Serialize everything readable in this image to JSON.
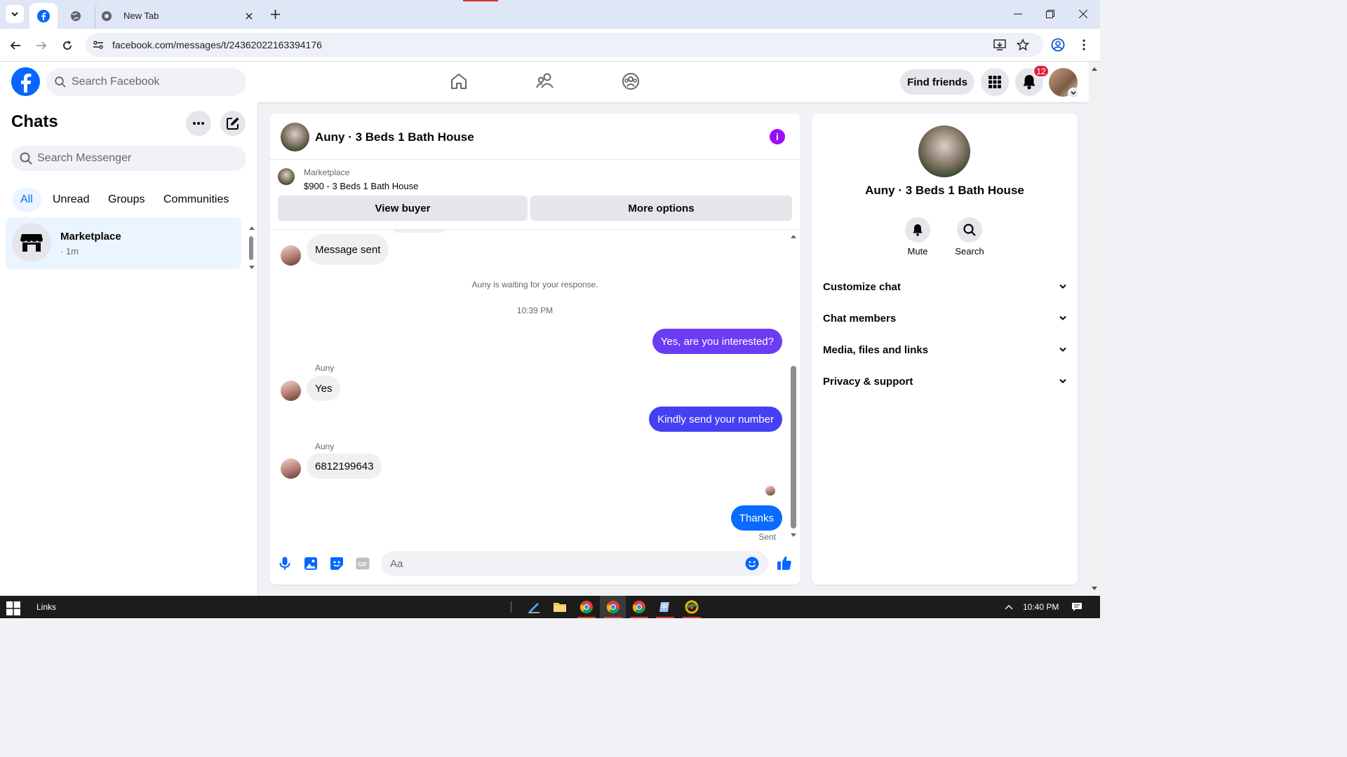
{
  "browser": {
    "tabs": [
      {
        "label": "",
        "icon": "facebook-icon",
        "active": true
      },
      {
        "label": "",
        "icon": "globe-icon"
      },
      {
        "label": "New Tab",
        "icon": "chrome-icon"
      }
    ],
    "url": "facebook.com/messages/t/24362022163394176"
  },
  "fb": {
    "search_placeholder": "Search Facebook",
    "find_friends": "Find friends",
    "notification_count": "12"
  },
  "chats": {
    "title": "Chats",
    "search_placeholder": "Search Messenger",
    "filters": [
      "All",
      "Unread",
      "Groups",
      "Communities"
    ],
    "items": [
      {
        "name": "Marketplace",
        "sub": "· 1m"
      }
    ]
  },
  "conversation": {
    "title": "Auny · 3 Beds 1 Bath House",
    "marketplace_label": "Marketplace",
    "listing": "$900 - 3 Beds 1 Bath House",
    "view_buyer": "View buyer",
    "more_options": "More options",
    "messages": {
      "m1": "Message sent",
      "waiting": "Auny is waiting for your response.",
      "time": "10:39 PM",
      "m2": "Yes, are you interested?",
      "sender": "Auny",
      "m3": "Yes",
      "m4": "Kindly send your number",
      "m5": "6812199643",
      "m6": "Thanks",
      "status": "Sent"
    },
    "composer_placeholder": "Aa"
  },
  "info": {
    "name": "Auny · 3 Beds 1 Bath House",
    "actions": [
      "Mute",
      "Search"
    ],
    "sections": [
      "Customize chat",
      "Chat members",
      "Media, files and links",
      "Privacy & support"
    ]
  },
  "taskbar": {
    "links": "Links",
    "clock": "10:40 PM"
  },
  "colors": {
    "fb_blue": "#0866ff",
    "outgoing_purple": "#6c3cf5",
    "outgoing_blue": "#0a6cff",
    "badge_red": "#e41e3f"
  }
}
